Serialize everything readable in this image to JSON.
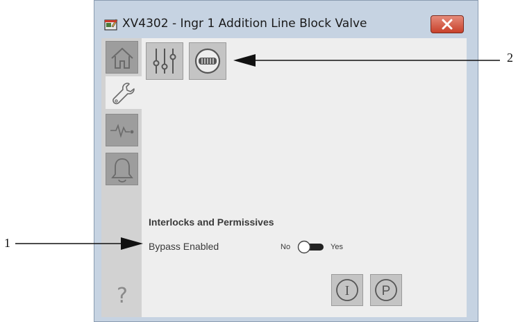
{
  "window": {
    "title": "XV4302 - Ingr 1 Addition Line Block Valve",
    "close_icon": "close-x-icon"
  },
  "navigation": {
    "items": [
      {
        "name": "home",
        "icon": "home-icon",
        "active": false
      },
      {
        "name": "maintenance",
        "icon": "wrench-icon",
        "active": true
      },
      {
        "name": "trends",
        "icon": "trend-icon",
        "active": false
      },
      {
        "name": "alarms",
        "icon": "bell-icon",
        "active": false
      }
    ],
    "help_label": "?"
  },
  "toolbar": {
    "buttons": [
      {
        "name": "parameters",
        "icon": "sliders-icon"
      },
      {
        "name": "bypass",
        "icon": "bypass-dial-icon"
      }
    ]
  },
  "interlocks": {
    "heading": "Interlocks and Permissives",
    "bypass_label": "Bypass Enabled",
    "toggle_off_label": "No",
    "toggle_on_label": "Yes",
    "toggle_state": "No"
  },
  "footer": {
    "buttons": [
      {
        "name": "interlocks",
        "icon": "interlock-i-icon",
        "glyph": "I"
      },
      {
        "name": "permissives",
        "icon": "permissive-p-icon",
        "glyph": "P"
      }
    ]
  },
  "callouts": {
    "callout_1": "1",
    "callout_2": "2"
  },
  "colors": {
    "close_button": "#c8412b",
    "nav_inactive": "#9d9d9d",
    "nav_active": "#eeeeee",
    "content_background": "#eeeeee",
    "frame": "#c6d3e2"
  }
}
